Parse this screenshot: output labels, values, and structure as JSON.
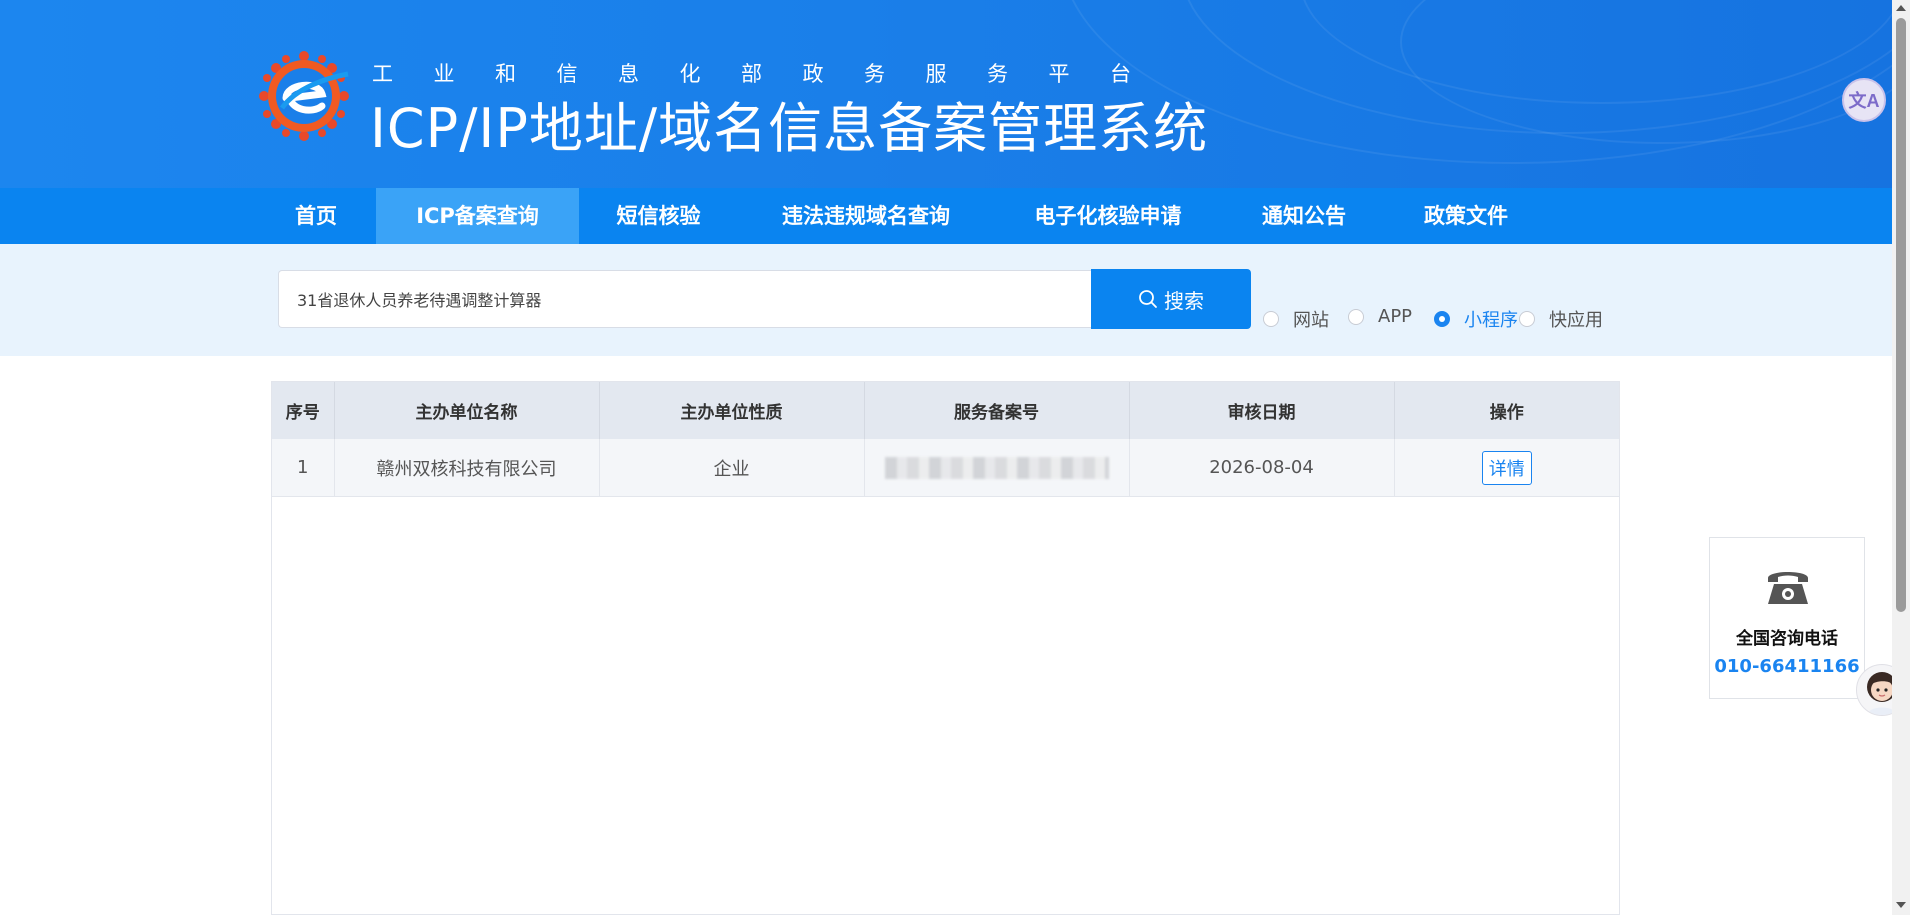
{
  "header": {
    "ministry_text": "工业和信息化部政务服务平台",
    "system_name": "ICP/IP地址/域名信息备案管理系统",
    "translate_badge": "文A"
  },
  "nav": {
    "items": [
      {
        "label": "首页"
      },
      {
        "label": "ICP备案查询",
        "active": true
      },
      {
        "label": "短信核验"
      },
      {
        "label": "违法违规域名查询"
      },
      {
        "label": "电子化核验申请"
      },
      {
        "label": "通知公告"
      },
      {
        "label": "政策文件"
      }
    ]
  },
  "search": {
    "value": "31省退休人员养老待遇调整计算器",
    "button_label": "搜索",
    "types": [
      {
        "label": "网站",
        "checked": false
      },
      {
        "label": "APP",
        "checked": false
      },
      {
        "label": "小程序",
        "checked": true
      },
      {
        "label": "快应用",
        "checked": false
      }
    ]
  },
  "table": {
    "headers": [
      "序号",
      "主办单位名称",
      "主办单位性质",
      "服务备案号",
      "审核日期",
      "操作"
    ],
    "rows": [
      {
        "index": "1",
        "org_name": "赣州双核科技有限公司",
        "org_type": "企业",
        "record_no": "",
        "audit_date": "2026-08-04",
        "action": "详情"
      }
    ]
  },
  "consult": {
    "title": "全国咨询电话",
    "phone": "010-66411166"
  },
  "colors": {
    "primary": "#0a84f0",
    "nav_active": "#3aa3f7",
    "search_band": "#e8f3fd"
  }
}
